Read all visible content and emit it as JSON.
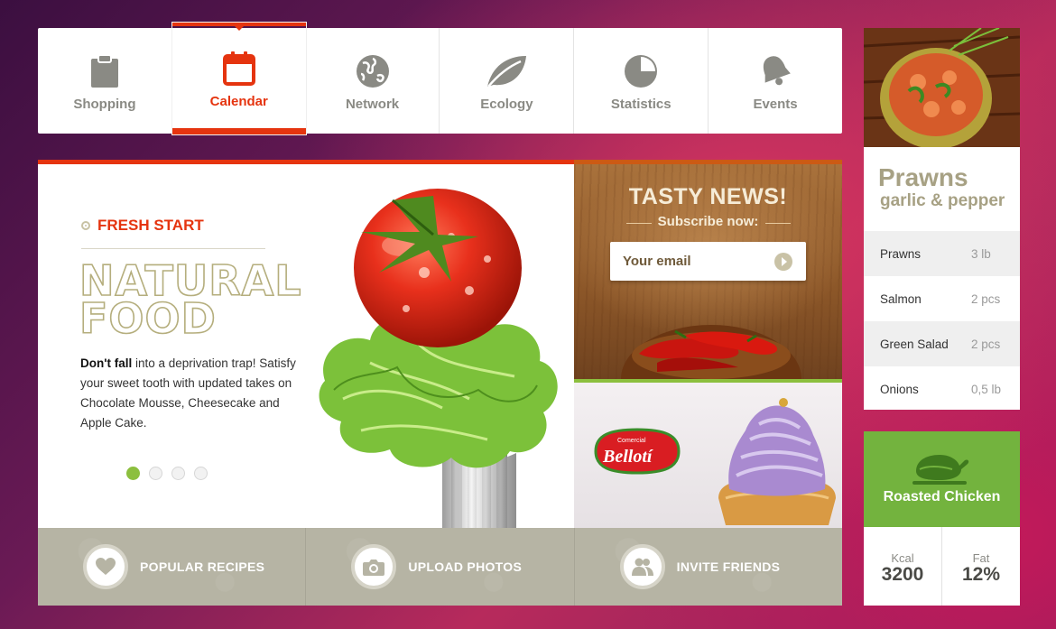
{
  "nav": {
    "items": [
      {
        "label": "Shopping",
        "icon": "clipboard-icon",
        "active": false
      },
      {
        "label": "Calendar",
        "icon": "calendar-icon",
        "active": true
      },
      {
        "label": "Network",
        "icon": "globe-icon",
        "active": false
      },
      {
        "label": "Ecology",
        "icon": "leaf-icon",
        "active": false
      },
      {
        "label": "Statistics",
        "icon": "pie-chart-icon",
        "active": false
      },
      {
        "label": "Events",
        "icon": "bell-icon",
        "active": false
      }
    ]
  },
  "hero": {
    "kicker": "FRESH START",
    "title_line1": "NATURAL",
    "title_line2": "FOOD",
    "text_bold": "Don't fall",
    "text_rest": " into a deprivation trap! Satisfy your sweet tooth with updated takes on Chocolate Mousse, Cheesecake and Apple Cake.",
    "slides_total": 4,
    "slide_active": 1
  },
  "news": {
    "title": "TASTY NEWS!",
    "subtitle": "Subscribe now:",
    "email_placeholder": "Your email"
  },
  "promo": {
    "brand_small": "Comercial",
    "brand": "Bellotí"
  },
  "actions": [
    {
      "label": "POPULAR RECIPES",
      "icon": "heart-icon"
    },
    {
      "label": "UPLOAD PHOTOS",
      "icon": "camera-icon"
    },
    {
      "label": "INVITE FRIENDS",
      "icon": "friends-icon"
    }
  ],
  "recipe": {
    "title": "Prawns",
    "subtitle": "garlic & pepper",
    "ingredients": [
      {
        "name": "Prawns",
        "qty": "3 lb"
      },
      {
        "name": "Salmon",
        "qty": "2 pcs"
      },
      {
        "name": "Green Salad",
        "qty": "2 pcs"
      },
      {
        "name": "Onions",
        "qty": "0,5 lb"
      }
    ]
  },
  "chicken": {
    "title": "Roasted Chicken",
    "kcal_label": "Kcal",
    "kcal_value": "3200",
    "fat_label": "Fat",
    "fat_value": "12%"
  },
  "colors": {
    "accent_red": "#e5340f",
    "accent_green": "#8cbf3e",
    "muted_gray": "#8a8a84",
    "action_bar": "#b6b4a4"
  }
}
